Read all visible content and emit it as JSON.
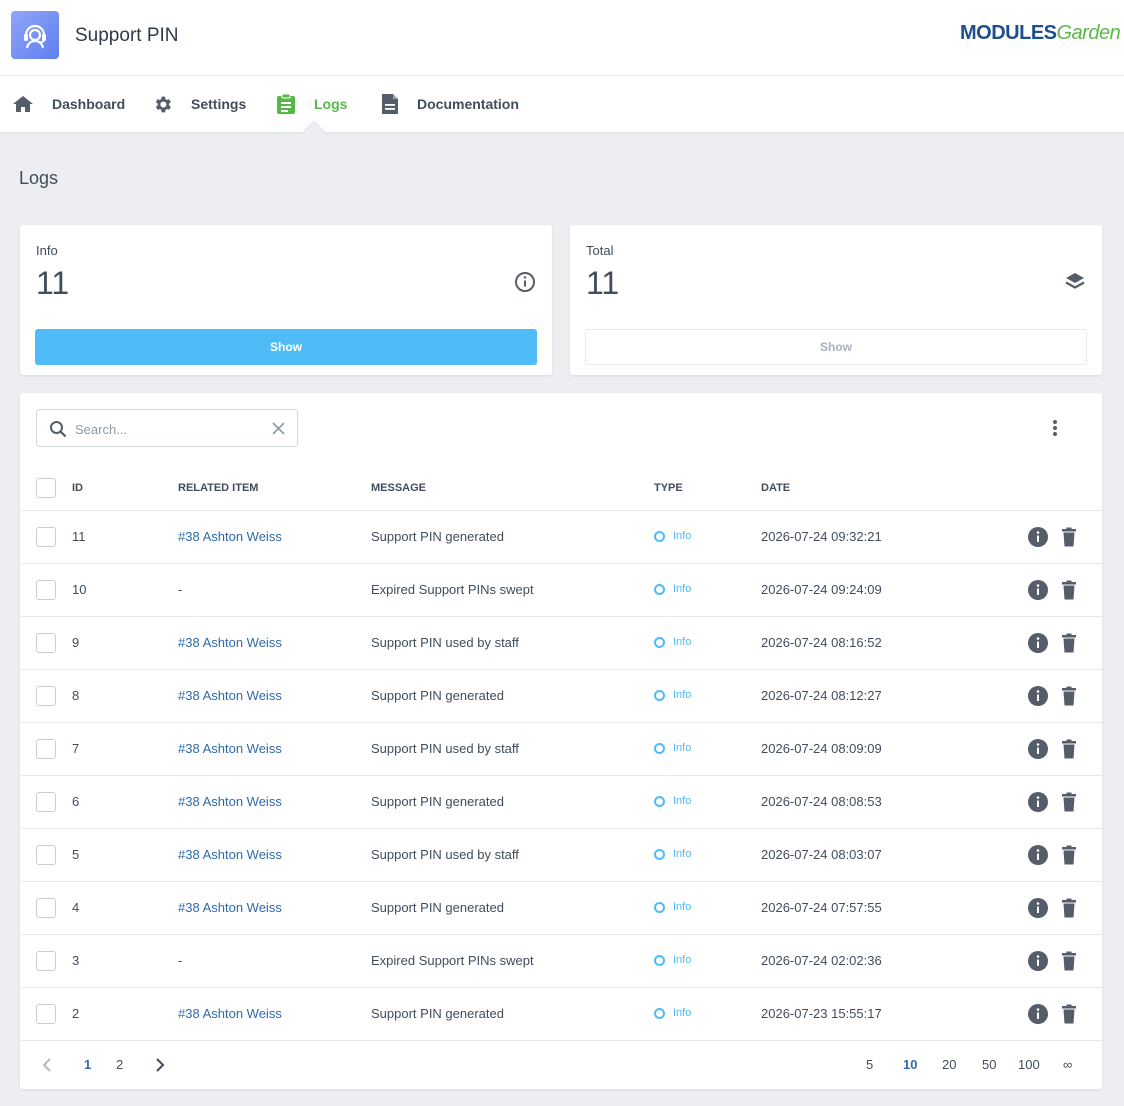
{
  "app": {
    "title": "Support PIN",
    "brand_strong": "MODULES",
    "brand_light": "Garden"
  },
  "nav": [
    {
      "label": "Dashboard",
      "icon": "home-icon"
    },
    {
      "label": "Settings",
      "icon": "gear-icon"
    },
    {
      "label": "Logs",
      "icon": "clipboard-icon",
      "active": true
    },
    {
      "label": "Documentation",
      "icon": "document-icon"
    }
  ],
  "page": {
    "title": "Logs"
  },
  "stats": {
    "info": {
      "label": "Info",
      "value": "11",
      "button": "Show",
      "icon": "info-circle-icon"
    },
    "total": {
      "label": "Total",
      "value": "11",
      "button": "Show",
      "icon": "layers-icon"
    }
  },
  "search": {
    "placeholder": "Search...",
    "value": ""
  },
  "table": {
    "headers": {
      "id": "ID",
      "related": "Related Item",
      "message": "Message",
      "type": "Type",
      "date": "Date"
    },
    "rows": [
      {
        "id": "11",
        "related": "#38 Ashton Weiss",
        "message": "Support PIN generated",
        "type": "Info",
        "date": "2026-07-24 09:32:21"
      },
      {
        "id": "10",
        "related": "-",
        "message": "Expired Support PINs swept",
        "type": "Info",
        "date": "2026-07-24 09:24:09"
      },
      {
        "id": "9",
        "related": "#38 Ashton Weiss",
        "message": "Support PIN used by staff",
        "type": "Info",
        "date": "2026-07-24 08:16:52"
      },
      {
        "id": "8",
        "related": "#38 Ashton Weiss",
        "message": "Support PIN generated",
        "type": "Info",
        "date": "2026-07-24 08:12:27"
      },
      {
        "id": "7",
        "related": "#38 Ashton Weiss",
        "message": "Support PIN used by staff",
        "type": "Info",
        "date": "2026-07-24 08:09:09"
      },
      {
        "id": "6",
        "related": "#38 Ashton Weiss",
        "message": "Support PIN generated",
        "type": "Info",
        "date": "2026-07-24 08:08:53"
      },
      {
        "id": "5",
        "related": "#38 Ashton Weiss",
        "message": "Support PIN used by staff",
        "type": "Info",
        "date": "2026-07-24 08:03:07"
      },
      {
        "id": "4",
        "related": "#38 Ashton Weiss",
        "message": "Support PIN generated",
        "type": "Info",
        "date": "2026-07-24 07:57:55"
      },
      {
        "id": "3",
        "related": "-",
        "message": "Expired Support PINs swept",
        "type": "Info",
        "date": "2026-07-24 02:02:36"
      },
      {
        "id": "2",
        "related": "#38 Ashton Weiss",
        "message": "Support PIN generated",
        "type": "Info",
        "date": "2026-07-23 15:55:17"
      }
    ]
  },
  "pagination": {
    "pages": [
      "1",
      "2"
    ],
    "current_page": "1",
    "page_sizes": [
      "5",
      "10",
      "20",
      "50",
      "100",
      "∞"
    ],
    "current_size": "10"
  },
  "colors": {
    "accent": "#54b946",
    "primary": "#4fbcf7",
    "link": "#2f6ba8"
  }
}
